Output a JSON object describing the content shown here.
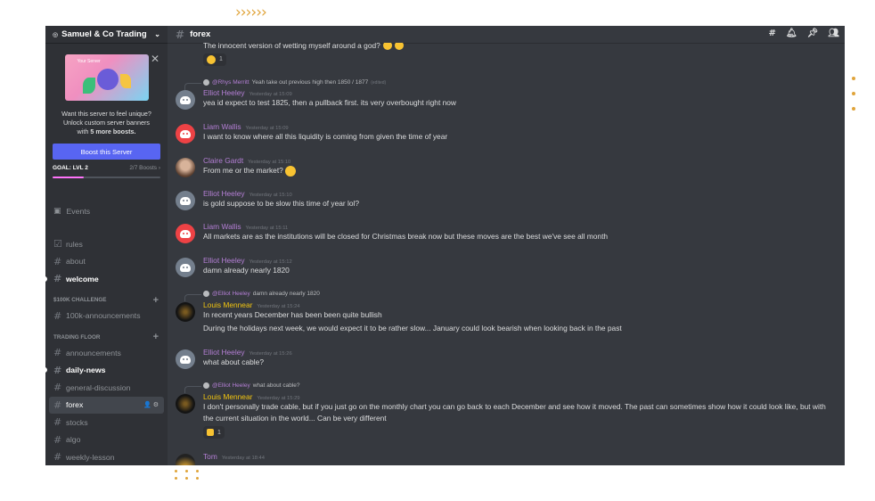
{
  "decor": {
    "arrows": "››››››"
  },
  "server": {
    "name": "Samuel & Co Trading"
  },
  "boost": {
    "banner_label": "Your Server",
    "text_line1": "Want this server to feel unique?",
    "text_line2": "Unlock custom server banners",
    "text_line3_pre": "with ",
    "text_line3_bold": "5 more boosts.",
    "button": "Boost this Server",
    "goal_label": "GOAL: LVL 2",
    "goal_progress": "2/7 Boosts ›",
    "goal_fraction": 0.29
  },
  "sidebar": {
    "events": "Events",
    "channels_top": [
      {
        "label": "rules",
        "icon": "rules-icon"
      },
      {
        "label": "about"
      },
      {
        "label": "welcome"
      }
    ],
    "category1": "$100K CHALLENGE",
    "cat1_channels": [
      {
        "label": "100k-announcements"
      }
    ],
    "category2": "TRADING FLOOR",
    "cat2_channels": [
      {
        "label": "announcements"
      },
      {
        "label": "daily-news"
      },
      {
        "label": "general-discussion"
      },
      {
        "label": "forex"
      },
      {
        "label": "stocks"
      },
      {
        "label": "algo"
      },
      {
        "label": "weekly-lesson"
      }
    ]
  },
  "channel": {
    "name": "forex"
  },
  "messages": {
    "top_cut": "The innocent version of wetting myself around a god?",
    "top_reaction_count": "1",
    "m1": {
      "reply_user": "@Rhys Merritt",
      "reply_text": "Yeah take out previous high then 1850 / 1877",
      "reply_edited": "(edited)",
      "user": "Elliot Heeley",
      "time": "Yesterday at 15:09",
      "text": "yea id expect to test 1825, then a pullback first. its very overbought right now"
    },
    "m2": {
      "user": "Liam Wallis",
      "time": "Yesterday at 15:09",
      "text": "I want to know where all this liquidity is coming from given the time of year"
    },
    "m3": {
      "user": "Claire Gardt",
      "time": "Yesterday at 15:10",
      "text": "From me or the market?"
    },
    "m4": {
      "user": "Elliot Heeley",
      "time": "Yesterday at 15:10",
      "text": "is gold suppose to be slow this time of year lol?"
    },
    "m5": {
      "user": "Liam Wallis",
      "time": "Yesterday at 15:11",
      "text": "All markets are as the institutions will be closed for Christmas break now but these moves are the best we've see all month"
    },
    "m6": {
      "user": "Elliot Heeley",
      "time": "Yesterday at 15:12",
      "text": "damn already nearly 1820"
    },
    "m7": {
      "reply_user": "@Elliot Heeley",
      "reply_text": "damn already nearly 1820",
      "user": "Louis Mennear",
      "time": "Yesterday at 15:24",
      "text1": "In recent years December has been been quite bullish",
      "text2": "During the holidays next week, we would expect it to be rather slow... January could look bearish when looking back in the past"
    },
    "m8": {
      "user": "Elliot Heeley",
      "time": "Yesterday at 15:26",
      "text": "what about cable?"
    },
    "m9": {
      "reply_user": "@Elliot Heeley",
      "reply_text": "what about cable?",
      "user": "Louis Mennear",
      "time": "Yesterday at 15:29",
      "text": "I don't personally trade cable, but if you just go on the monthly chart you can go back to each December and see how it moved. The past can sometimes show how it could look like, but with the current situation in the world... Can be very different",
      "reaction_count": "1"
    },
    "m10": {
      "user": "Tom",
      "time": "Yesterday at 18:44"
    }
  }
}
